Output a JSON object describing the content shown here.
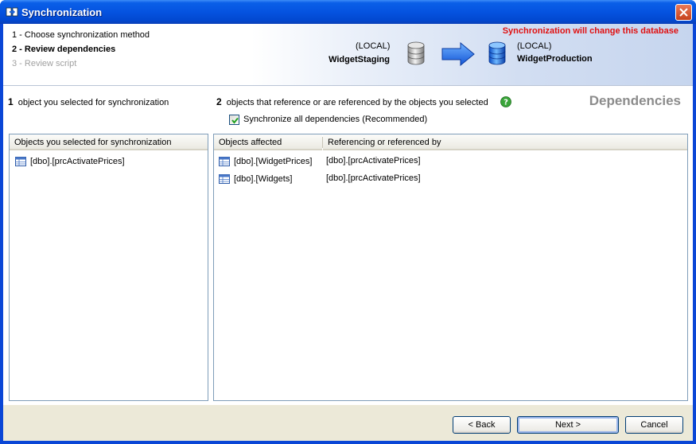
{
  "window": {
    "title": "Synchronization"
  },
  "steps": [
    {
      "label": "1 - Choose synchronization method",
      "state": "done"
    },
    {
      "label": "2 - Review dependencies",
      "state": "current"
    },
    {
      "label": "3 - Review script",
      "state": "disabled"
    }
  ],
  "banner": {
    "warning": "Synchronization will change this database",
    "source": {
      "server": "(LOCAL)",
      "database": "WidgetStaging"
    },
    "target": {
      "server": "(LOCAL)",
      "database": "WidgetProduction"
    }
  },
  "summary": {
    "selected_count": "1",
    "selected_text": "object you selected for synchronization",
    "related_count": "2",
    "related_text": "objects that reference or are referenced by the objects you selected",
    "section_title": "Dependencies",
    "sync_all_label": "Synchronize all dependencies (Recommended)",
    "sync_all_checked": true
  },
  "selected_panel": {
    "header": "Objects you selected for synchronization",
    "rows": [
      "[dbo].[prcActivatePrices]"
    ]
  },
  "dependencies_panel": {
    "headers": [
      "Objects affected",
      "Referencing or referenced by"
    ],
    "rows": [
      {
        "object": "[dbo].[WidgetPrices]",
        "related": "[dbo].[prcActivatePrices]"
      },
      {
        "object": "[dbo].[Widgets]",
        "related": "[dbo].[prcActivatePrices]"
      }
    ]
  },
  "buttons": {
    "back": "< Back",
    "next": "Next >",
    "cancel": "Cancel"
  },
  "colors": {
    "warning": "#e01010",
    "section_title": "#8c8c8c",
    "titlebar": "#0553e0"
  }
}
